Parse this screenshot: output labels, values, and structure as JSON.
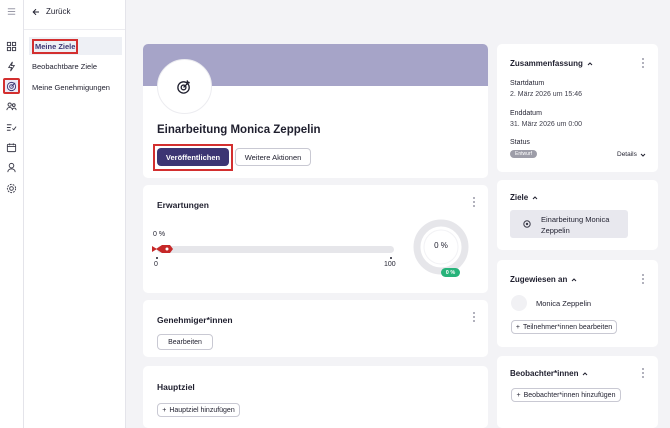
{
  "nav": {
    "back_label": "Zurück",
    "items": [
      {
        "label": "Meine Ziele",
        "selected": true
      },
      {
        "label": "Beobachtbare Ziele",
        "selected": false
      },
      {
        "label": "Meine Genehmigungen",
        "selected": false
      }
    ]
  },
  "rail_icons": [
    "menu-icon",
    "dashboard-icon",
    "lightning-icon",
    "target-icon",
    "people-icon",
    "list-check-icon",
    "calendar-icon",
    "org-icon",
    "settings-icon"
  ],
  "goal": {
    "title": "Einarbeitung Monica Zeppelin",
    "publish_label": "Veröffentlichen",
    "more_label": "Weitere Aktionen"
  },
  "expectations": {
    "title": "Erwartungen",
    "progress_label": "0 %",
    "progress": 0,
    "tick_min": "0",
    "tick_max": "100",
    "donut_label": "0 %",
    "badge": "0 %"
  },
  "approvers": {
    "title": "Genehmiger*innen",
    "edit_label": "Bearbeiten"
  },
  "main_goal": {
    "title": "Hauptziel",
    "add_label": "Hauptziel hinzufügen"
  },
  "summary": {
    "title": "Zusammenfassung",
    "start_label": "Startdatum",
    "start_value": "2. März 2026 um 15:46",
    "end_label": "Enddatum",
    "end_value": "31. März 2026 um 0:00",
    "status_label": "Status",
    "status_value": "Entwurf",
    "details_label": "Details"
  },
  "goals_card": {
    "title": "Ziele",
    "item": "Einarbeitung Monica Zeppelin"
  },
  "assigned": {
    "title": "Zugewiesen an",
    "person": "Monica Zeppelin",
    "edit_label": "Teilnehmer*innen bearbeiten"
  },
  "observers": {
    "title": "Beobachter*innen",
    "add_label": "Beobachter*innen hinzufügen"
  },
  "colors": {
    "primary": "#3c3573",
    "banner": "#a6a4c8",
    "highlight": "#d32f2f",
    "success": "#27b37a"
  }
}
